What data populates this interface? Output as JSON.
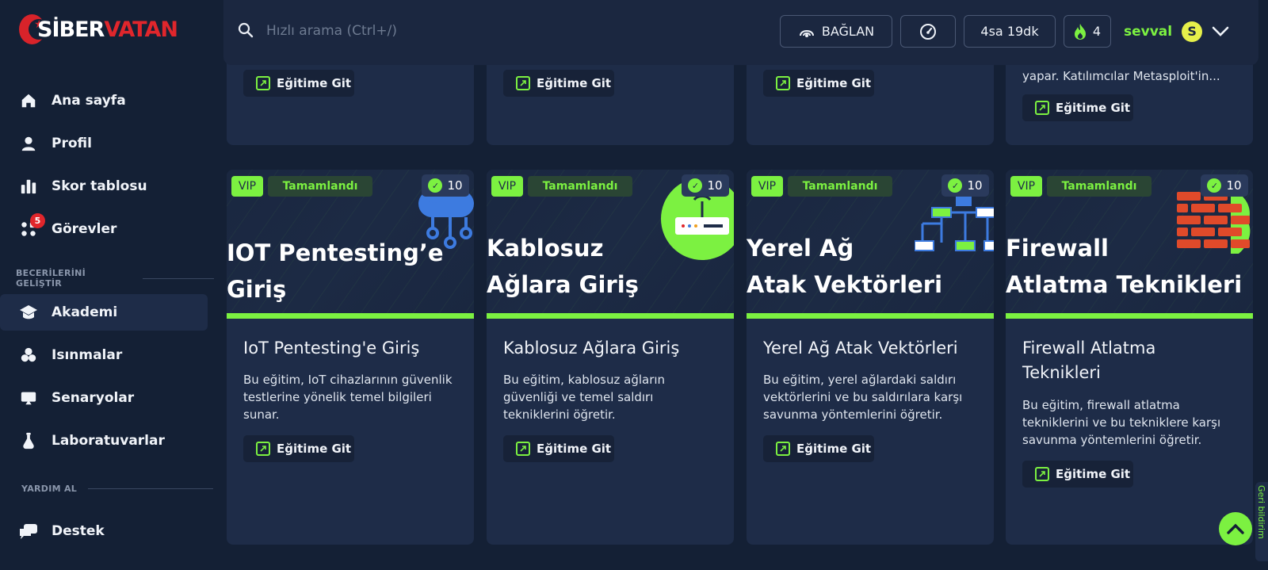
{
  "brand": {
    "logo_text_white": "SİBER",
    "logo_text_red": "VATAN"
  },
  "sidebar": {
    "items": [
      {
        "label": "Ana sayfa",
        "icon": "home-icon"
      },
      {
        "label": "Profil",
        "icon": "user-icon"
      },
      {
        "label": "Skor tablosu",
        "icon": "bar-chart-icon"
      },
      {
        "label": "Görevler",
        "icon": "tasks-icon",
        "badge": "5"
      },
      {
        "label": "Akademi",
        "icon": "graduation-cap-icon",
        "active": true
      },
      {
        "label": "Isınmalar",
        "icon": "warmup-icon"
      },
      {
        "label": "Senaryolar",
        "icon": "scenario-icon"
      },
      {
        "label": "Laboratuvarlar",
        "icon": "flask-icon"
      },
      {
        "label": "Destek",
        "icon": "chat-icon"
      }
    ],
    "section_skills": "BECERİLERİNİ GELİŞTİR",
    "section_help": "YARDIM AL"
  },
  "topbar": {
    "search_placeholder": "Hızlı arama (Ctrl+/)",
    "connect_label": "BAĞLAN",
    "timer_label": "4sa 19dk",
    "streak_count": "4",
    "username": "sevval",
    "avatar_letter": "S"
  },
  "top_row": {
    "button_label": "Eğitime Git",
    "last_card_desc_line1": "yapar. Katılımcılar Metasploit'in...",
    "last_card_desc_line0": "y"
  },
  "courses": [
    {
      "vip": "VIP",
      "status": "Tamamlandı",
      "points": "10",
      "banner_line1": "IOT Pentesting’e",
      "banner_line2": "Giriş",
      "title": "IoT Pentesting'e Giriş",
      "description": "Bu eğitim, IoT cihazlarının güvenlik testlerine yönelik temel bilgileri sunar.",
      "button": "Eğitime Git"
    },
    {
      "vip": "VIP",
      "status": "Tamamlandı",
      "points": "10",
      "banner_line1": "Kablosuz",
      "banner_line2": "Ağlara Giriş",
      "title": "Kablosuz Ağlara Giriş",
      "description": "Bu eğitim, kablosuz ağların güvenliği ve temel saldırı tekniklerini öğretir.",
      "button": "Eğitime Git"
    },
    {
      "vip": "VIP",
      "status": "Tamamlandı",
      "points": "10",
      "banner_line1": "Yerel Ağ",
      "banner_line2": "Atak Vektörleri",
      "title": "Yerel Ağ Atak Vektörleri",
      "description": "Bu eğitim, yerel ağlardaki saldırı vektörlerini ve bu saldırılara karşı savunma yöntemlerini öğretir.",
      "button": "Eğitime Git"
    },
    {
      "vip": "VIP",
      "status": "Tamamlandı",
      "points": "10",
      "banner_line1": "Firewall",
      "banner_line2": "Atlatma Teknikleri",
      "title": "Firewall Atlatma Teknikleri",
      "description": "Bu eğitim, firewall atlatma tekniklerini ve bu tekniklere karşı savunma yöntemlerini öğretir.",
      "button": "Eğitime Git"
    }
  ],
  "feedback_label": "Geri bildirim",
  "colors": {
    "accent": "#7cf141",
    "background": "#142035",
    "card": "#1e2c48",
    "brand_red": "#e0262c"
  }
}
